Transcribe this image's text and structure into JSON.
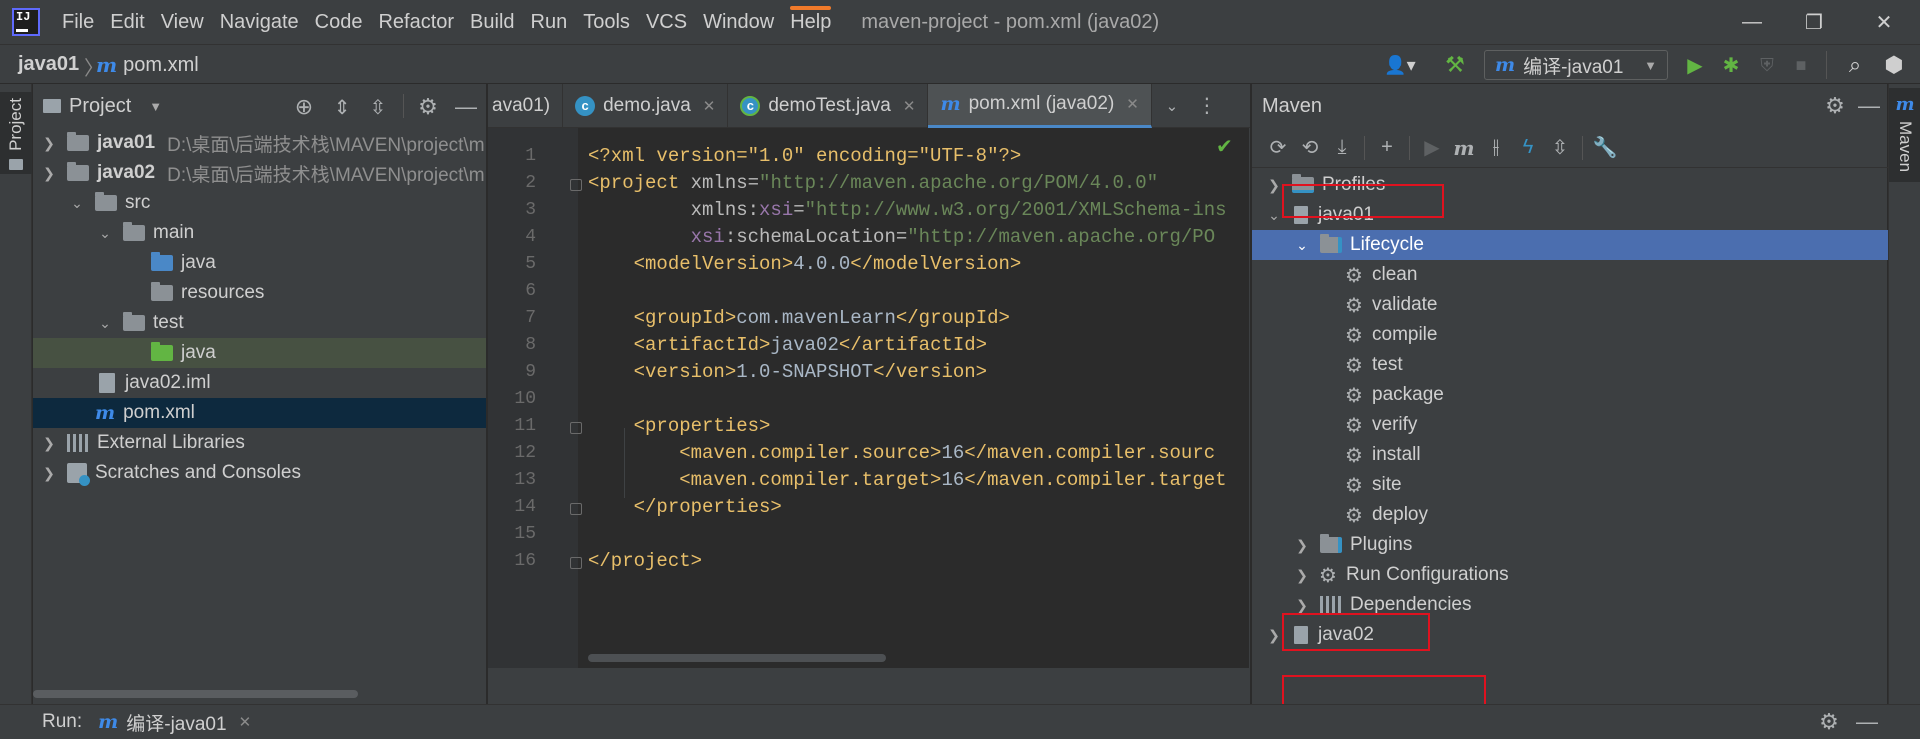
{
  "menubar": {
    "logo_text": "IJ",
    "items": [
      "File",
      "Edit",
      "View",
      "Navigate",
      "Code",
      "Refactor",
      "Build",
      "Run",
      "Tools",
      "VCS",
      "Window",
      "Help"
    ],
    "window_title": "maven-project - pom.xml (java02)"
  },
  "navbar": {
    "project": "java01",
    "separator": "〉",
    "file": "pom.xml",
    "run_config": "编译-java01"
  },
  "left_stripe": {
    "project_label": "Project"
  },
  "project_panel": {
    "title": "Project",
    "tree": [
      {
        "label": "java01",
        "path": "D:\\桌面\\后端技术栈\\MAVEN\\project\\m"
      },
      {
        "label": "java02",
        "path": "D:\\桌面\\后端技术栈\\MAVEN\\project\\m"
      },
      {
        "label": "src"
      },
      {
        "label": "main"
      },
      {
        "label": "java"
      },
      {
        "label": "resources"
      },
      {
        "label": "test"
      },
      {
        "label": "java"
      },
      {
        "label": "java02.iml"
      },
      {
        "label": "pom.xml"
      },
      {
        "label": "External Libraries"
      },
      {
        "label": "Scratches and Consoles"
      }
    ]
  },
  "editor": {
    "tabs": [
      {
        "label": "ava01)"
      },
      {
        "label": "demo.java"
      },
      {
        "label": "demoTest.java"
      },
      {
        "label": "pom.xml (java02)"
      }
    ],
    "line_numbers": [
      "1",
      "2",
      "3",
      "4",
      "5",
      "6",
      "7",
      "8",
      "9",
      "10",
      "11",
      "12",
      "13",
      "14",
      "15",
      "16"
    ],
    "code": {
      "l1": "<?xml version=\"1.0\" encoding=\"UTF-8\"?>",
      "l2_tag": "<project",
      "l2_attr": " xmlns=",
      "l2_val": "\"http://maven.apache.org/POM/4.0.0\"",
      "l3_pre": "         xmlns:",
      "l3_ns": "xsi",
      "l3_eq": "=",
      "l3_val": "\"http://www.w3.org/2001/XMLSchema-ins",
      "l4_ns": "         xsi",
      "l4_attr": ":schemaLocation=",
      "l4_val": "\"http://maven.apache.org/PO",
      "l5_open": "    <modelVersion>",
      "l5_val": "4.0.0",
      "l5_close": "</modelVersion>",
      "l7_open": "    <groupId>",
      "l7_val": "com.mavenLearn",
      "l7_close": "</groupId>",
      "l8_open": "    <artifactId>",
      "l8_val": "java02",
      "l8_close": "</artifactId>",
      "l9_open": "    <version>",
      "l9_val": "1.0-SNAPSHOT",
      "l9_close": "</version>",
      "l11": "    <properties>",
      "l12_open": "        <maven.compiler.source>",
      "l12_val": "16",
      "l12_close": "</maven.compiler.sourc",
      "l13_open": "        <maven.compiler.target>",
      "l13_val": "16",
      "l13_close": "</maven.compiler.target",
      "l14": "    </properties>",
      "l16": "</project>"
    }
  },
  "maven_panel": {
    "title": "Maven",
    "tree": {
      "profiles": "Profiles",
      "java01": "java01",
      "lifecycle": "Lifecycle",
      "goals": [
        "clean",
        "validate",
        "compile",
        "test",
        "package",
        "verify",
        "install",
        "site",
        "deploy"
      ],
      "plugins": "Plugins",
      "run_configurations": "Run Configurations",
      "dependencies": "Dependencies",
      "java02": "java02"
    }
  },
  "right_stripe": {
    "maven_label": "Maven"
  },
  "runbar": {
    "label": "Run:",
    "config": "编译-java01"
  },
  "colors": {
    "menubar_bg": "#3c3f41",
    "editor_bg": "#2b2b2b",
    "selection_blue": "#4b6eaf",
    "highlight_box": "#e0121f",
    "xml_tag": "#e8bf6a",
    "xml_string": "#6a8759"
  }
}
